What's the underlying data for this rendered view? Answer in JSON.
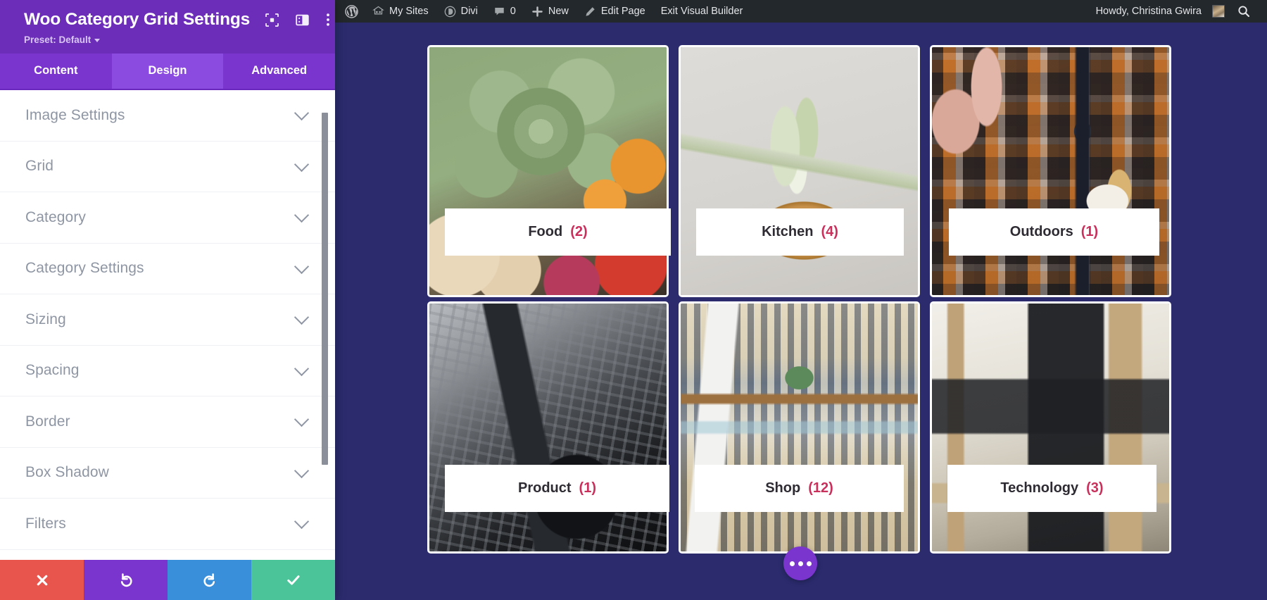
{
  "sidebar": {
    "title": "Woo Category Grid Settings",
    "preset_label": "Preset: Default",
    "header_icons": [
      {
        "name": "focus-icon"
      },
      {
        "name": "panel-layout-icon"
      },
      {
        "name": "more-vertical-icon"
      }
    ],
    "tabs": [
      {
        "label": "Content",
        "active": false
      },
      {
        "label": "Design",
        "active": true
      },
      {
        "label": "Advanced",
        "active": false
      }
    ],
    "items": [
      {
        "label": "Image Settings"
      },
      {
        "label": "Grid"
      },
      {
        "label": "Category"
      },
      {
        "label": "Category Settings"
      },
      {
        "label": "Sizing"
      },
      {
        "label": "Spacing"
      },
      {
        "label": "Border"
      },
      {
        "label": "Box Shadow"
      },
      {
        "label": "Filters"
      }
    ],
    "actions": [
      {
        "name": "cancel-button",
        "icon": "close-icon",
        "color": "#e8554d"
      },
      {
        "name": "undo-button",
        "icon": "undo-icon",
        "color": "#7b35cf"
      },
      {
        "name": "redo-button",
        "icon": "redo-icon",
        "color": "#3a8fdb"
      },
      {
        "name": "save-button",
        "icon": "check-icon",
        "color": "#4bc49a"
      }
    ]
  },
  "adminbar": {
    "items": [
      {
        "label": "",
        "icon": "wordpress-logo-icon"
      },
      {
        "label": "My Sites",
        "icon": "sites-icon"
      },
      {
        "label": "Divi",
        "icon": "divi-icon"
      },
      {
        "label": "0",
        "icon": "comment-icon"
      },
      {
        "label": "New",
        "icon": "plus-icon"
      },
      {
        "label": "Edit Page",
        "icon": "pencil-icon"
      },
      {
        "label": "Exit Visual Builder",
        "icon": ""
      }
    ],
    "howdy": "Howdy, Christina Gwira",
    "search_icon": "search-icon"
  },
  "grid": {
    "cards": [
      {
        "name": "Food",
        "count": "(2)",
        "art": "img-food",
        "cls": "food"
      },
      {
        "name": "Kitchen",
        "count": "(4)",
        "art": "img-kitchen",
        "cls": "kitchen"
      },
      {
        "name": "Outdoors",
        "count": "(1)",
        "art": "img-outdoors",
        "cls": "outdoors"
      },
      {
        "name": "Product",
        "count": "(1)",
        "art": "img-product",
        "cls": "product"
      },
      {
        "name": "Shop",
        "count": "(12)",
        "art": "img-shop",
        "cls": "shop"
      },
      {
        "name": "Technology",
        "count": "(3)",
        "art": "img-tech",
        "cls": "tech"
      }
    ]
  },
  "fab": {
    "name": "divi-settings-fab",
    "icon": "three-dots-icon"
  },
  "colors": {
    "sidebar_header": "#6c2eb9",
    "tab_bar": "#7b35cf",
    "tab_active": "#8b4ae0",
    "canvas_bg": "#2b2b6e",
    "adminbar_bg": "#23282d",
    "count_accent": "#c9305c",
    "card_name": "#2f2b33"
  }
}
